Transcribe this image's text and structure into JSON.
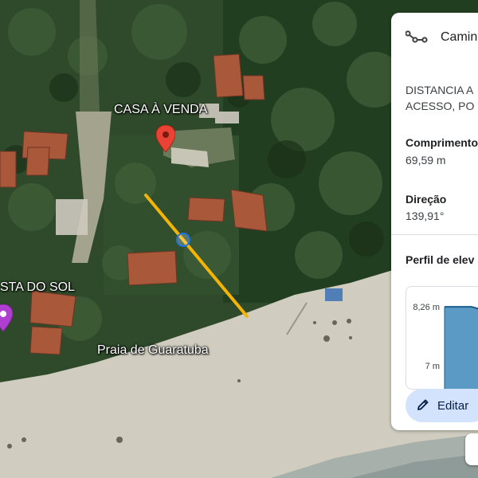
{
  "map": {
    "labels": {
      "casa": "CASA À VENDA",
      "costa": "STA DO SOL",
      "praia": "Praia de Guaratuba"
    },
    "icons": {
      "casa_pin": "map-pin-icon",
      "left_pin": "map-pin-icon",
      "beach_poi": "camera-icon",
      "measure_handle": "measure-handle-icon"
    }
  },
  "panel": {
    "title": "Camin",
    "description_line1": "DISTANCIA A",
    "description_line2": "ACESSO, PO",
    "length_label": "Comprimento",
    "length_value": "69,59 m",
    "direction_label": "Direção",
    "direction_value": "139,91°",
    "profile_title": "Perfil de elev",
    "edit_label": "Editar",
    "icons": {
      "path": "path-icon",
      "edit": "pencil-icon"
    }
  },
  "chart_data": {
    "type": "area",
    "title": "Perfil de elev",
    "xlabel": "",
    "ylabel": "",
    "y_tick_labels": [
      "8,26 m",
      "7 m"
    ],
    "x": [
      0,
      1,
      2,
      3
    ],
    "values": [
      8.26,
      8.26,
      8.1,
      7.6
    ],
    "ylim": [
      6.5,
      8.4
    ],
    "grid": false,
    "fill_color": "#5b9ac4"
  },
  "colors": {
    "measure_line": "#f4b400",
    "accent": "#1a73e8",
    "edit_button": "#d3e3fd"
  }
}
